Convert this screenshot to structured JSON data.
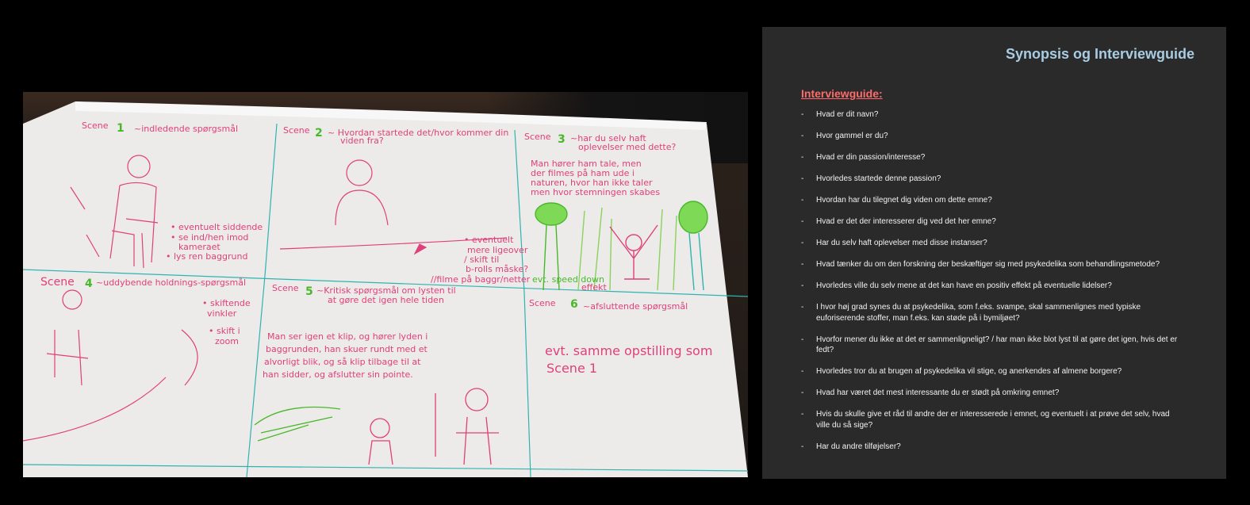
{
  "storyboard": {
    "scenes": [
      {
        "label": "Scene",
        "number": "1",
        "title": "~indledende spørgsmål",
        "notes": [
          "• eventuelt siddende",
          "• se ind/hen imod",
          "kameraet",
          "• lys ren baggrund"
        ]
      },
      {
        "label": "Scene",
        "number": "2",
        "title": "~ Hvordan startede det/hvor kommer din",
        "title2": "viden fra?",
        "notes": [
          "• eventuelt",
          "mere ligeover",
          "/ skift til",
          "b-rolls måske?",
          "//filme på baggr/netter"
        ]
      },
      {
        "label": "Scene",
        "number": "3",
        "title": "~har du selv haft",
        "title2": "oplevelser med dette?",
        "notes": [
          "Man hører ham tale, men",
          "der filmes på ham ude i",
          "naturen, hvor han ikke taler",
          "men hvor stemningen skabes",
          "evt. speed down",
          "effekt"
        ]
      },
      {
        "label": "Scene",
        "number": "4",
        "title": "~uddybende holdnings-spørgsmål",
        "notes": [
          "• skiftende",
          "vinkler",
          "• skift i",
          "zoom"
        ]
      },
      {
        "label": "Scene",
        "number": "5",
        "title": "~Kritisk spørgsmål om lysten til",
        "title2": "at gøre det igen hele tiden",
        "notes": [
          "Man ser igen et klip, og hører lyden i",
          "baggrunden, han skuer rundt med et",
          "alvorligt blik, og så klip tilbage til at",
          "han sidder, og afslutter sin pointe."
        ]
      },
      {
        "label": "Scene",
        "number": "6",
        "title": "~afsluttende spørgsmål",
        "notes": [
          "evt. samme opstilling som",
          "Scene 1"
        ]
      }
    ],
    "ink_color": "#e0407a",
    "number_color": "#48b82a"
  },
  "slide": {
    "title": "Synopsis og Interviewguide",
    "section_heading": "Interviewguide:",
    "bullet": "-",
    "questions": [
      "Hvad er dit navn?",
      "Hvor gammel er du?",
      "Hvad er din passion/interesse?",
      "Hvorledes startede denne passion?",
      "Hvordan har du tilegnet dig viden om dette emne?",
      "Hvad er det der interesserer dig ved det her emne?",
      "Har du selv haft oplevelser med disse instanser?",
      "Hvad tænker du om den forskning der beskæftiger sig med psykedelika som behandlingsmetode?",
      "Hvorledes ville du selv mene at det kan have en positiv effekt på eventuelle lidelser?",
      "I hvor høj grad synes du at psykedelika, som f.eks. svampe, skal sammenlignes med typiske euforiserende stoffer, man f.eks. kan støde på i bymiljøet?",
      "Hvorfor mener du ikke at det er sammenligneligt? / har man ikke blot lyst til at gøre det igen, hvis det er fedt?",
      "Hvorledes tror du at brugen af psykedelika vil stige, og anerkendes af almene borgere?",
      "Hvad har været det mest interessante du er stødt på omkring emnet?",
      "Hvis du skulle give et råd til andre der er interesserede i emnet, og eventuelt i at prøve det selv, hvad ville du så sige?",
      "Har du andre tilføjelser?"
    ],
    "title_color": "#a9cce3",
    "heading_color": "#ff6b6b"
  }
}
